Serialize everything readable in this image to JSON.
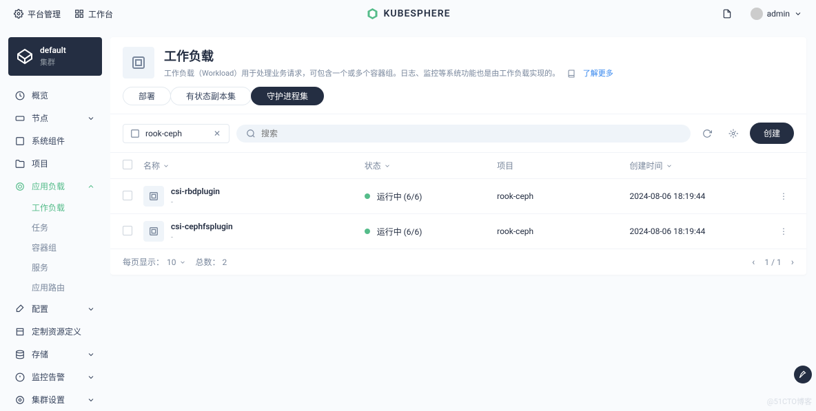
{
  "topbar": {
    "platform": "平台管理",
    "workspace": "工作台",
    "logo_text": "KUBESPHERE",
    "user": "admin"
  },
  "cluster": {
    "name": "default",
    "type": "集群"
  },
  "nav": {
    "overview": "概览",
    "nodes": "节点",
    "components": "系统组件",
    "projects": "项目",
    "workloads": {
      "label": "应用负载",
      "items": [
        "工作负载",
        "任务",
        "容器组",
        "服务",
        "应用路由"
      ]
    },
    "config": "配置",
    "crd": "定制资源定义",
    "storage": "存储",
    "monitoring": "监控告警",
    "cluster_settings": "集群设置"
  },
  "page": {
    "title": "工作负载",
    "desc": "工作负载（Workload）用于处理业务请求，可包含一个或多个容器组。日志、监控等系统功能也是由工作负载实现的。",
    "more": "了解更多"
  },
  "tabs": {
    "deployment": "部署",
    "statefulset": "有状态副本集",
    "daemonset": "守护进程集"
  },
  "toolbar": {
    "project_filter": "rook-ceph",
    "search_placeholder": "搜索",
    "create": "创建"
  },
  "columns": {
    "name": "名称",
    "status": "状态",
    "project": "项目",
    "created": "创建时间"
  },
  "rows": [
    {
      "name": "csi-rbdplugin",
      "sub": "-",
      "status": "运行中 (6/6)",
      "project": "rook-ceph",
      "time": "2024-08-06 18:19:44"
    },
    {
      "name": "csi-cephfsplugin",
      "sub": "-",
      "status": "运行中 (6/6)",
      "project": "rook-ceph",
      "time": "2024-08-06 18:19:44"
    }
  ],
  "pager": {
    "page_size_label": "每页显示：",
    "page_size": "10",
    "total_label": "总数：",
    "total": "2",
    "page_indicator": "1 / 1"
  },
  "watermark": "@51CTO博客"
}
